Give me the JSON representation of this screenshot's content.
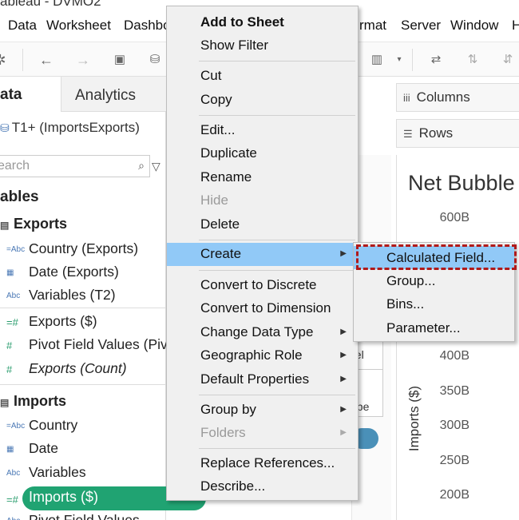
{
  "window": {
    "title": "ableau - DVMO2"
  },
  "menubar": {
    "items": [
      "Data",
      "Worksheet",
      "Dashbo",
      "rmat",
      "Server",
      "Window",
      "H"
    ]
  },
  "data_pane": {
    "tabs": [
      "ata",
      "Analytics"
    ],
    "datasource": "T1+ (ImportsExports)",
    "search_placeholder": "earch",
    "tables_heading": "ables",
    "groups": [
      {
        "name": "Exports",
        "fields": [
          {
            "icon": "Abc",
            "label": "Country (Exports)"
          },
          {
            "icon": "calendar",
            "label": "Date (Exports)"
          },
          {
            "icon": "Abc",
            "label": "Variables (T2)"
          },
          {
            "icon": "#",
            "label": "Exports ($)"
          },
          {
            "icon": "#",
            "label": "Pivot Field Values (Piv"
          },
          {
            "icon": "#",
            "label": "Exports (Count)"
          }
        ]
      },
      {
        "name": "Imports",
        "fields": [
          {
            "icon": "Abc",
            "label": "Country"
          },
          {
            "icon": "calendar",
            "label": "Date"
          },
          {
            "icon": "Abc",
            "label": "Variables"
          },
          {
            "icon": "#",
            "label": "Imports ($)"
          },
          {
            "icon": "Abc",
            "label": "Pivot Field Values"
          }
        ]
      }
    ]
  },
  "shelves": {
    "columns": "Columns",
    "rows": "Rows"
  },
  "marks": {
    "label_btn": "bel",
    "shape_btn": "ape"
  },
  "view": {
    "title": "Net Bubble",
    "y_ticks": [
      "600B",
      "400B",
      "350B",
      "300B",
      "250B",
      "200B"
    ],
    "y_label": "Imports ($)"
  },
  "context_menu": {
    "items": [
      "Add to Sheet",
      "Show Filter",
      "Cut",
      "Copy",
      "Edit...",
      "Duplicate",
      "Rename",
      "Hide",
      "Delete",
      "Create",
      "Convert to Discrete",
      "Convert to Dimension",
      "Change Data Type",
      "Geographic Role",
      "Default Properties",
      "Group by",
      "Folders",
      "Replace References...",
      "Describe..."
    ],
    "submenu": [
      "Calculated Field...",
      "Group...",
      "Bins...",
      "Parameter..."
    ]
  }
}
